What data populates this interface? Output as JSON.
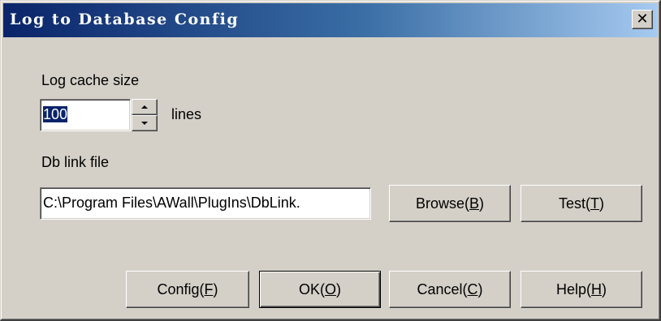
{
  "window": {
    "title": "Log to Database Config",
    "close_glyph": "✕"
  },
  "icons": {
    "close": "close-icon",
    "spin_up": "up-arrow-icon",
    "spin_down": "down-arrow-icon"
  },
  "colors": {
    "title_gradient_start": "#0a246a",
    "title_gradient_end": "#a6caf0",
    "face": "#d4d0c8",
    "selection": "#0a246a"
  },
  "log_cache": {
    "label": "Log cache size",
    "value": "100",
    "unit": "lines"
  },
  "db_link": {
    "label": "Db link file",
    "value": "C:\\Program Files\\AWall\\PlugIns\\DbLink."
  },
  "buttons": {
    "browse": {
      "text": "Browse(",
      "key": "B",
      "end": ")"
    },
    "test": {
      "text": "Test(",
      "key": "T",
      "end": ")"
    },
    "config": {
      "text": "Config(",
      "key": "F",
      "end": ")"
    },
    "ok": {
      "text": "OK(",
      "key": "O",
      "end": ")"
    },
    "cancel": {
      "text": "Cancel(",
      "key": "C",
      "end": ")"
    },
    "help": {
      "text": "Help(",
      "key": "H",
      "end": ")"
    }
  }
}
